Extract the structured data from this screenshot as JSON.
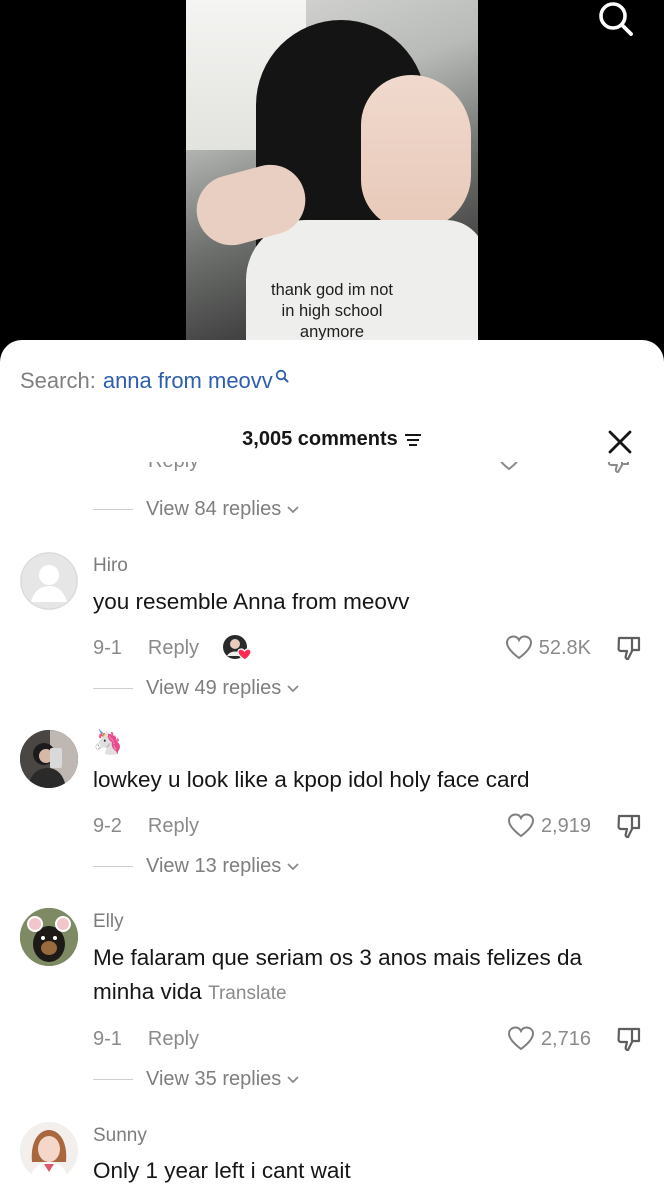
{
  "video": {
    "caption_lines": [
      "thank god im not",
      "in high school",
      "anymore"
    ]
  },
  "sheet": {
    "search_label": "Search:",
    "search_query": "anna from meovv",
    "comment_count": "3,005 comments",
    "cut_row": {
      "reply_label": "Reply"
    },
    "first_replies": "View 84 replies"
  },
  "comments": [
    {
      "username": "Hiro",
      "text": "you resemble Anna from meovv",
      "date": "9-1",
      "reply_label": "Reply",
      "likes": "52.8K",
      "replies": "View 49 replies",
      "creator_liked": true
    },
    {
      "username": "🦄",
      "text": "lowkey u look like a kpop idol holy face card",
      "date": "9-2",
      "reply_label": "Reply",
      "likes": "2,919",
      "replies": "View 13 replies"
    },
    {
      "username": "Elly",
      "text": "Me falaram que seriam os 3 anos mais felizes da minha vida",
      "translate_label": "Translate",
      "date": "9-1",
      "reply_label": "Reply",
      "likes": "2,716",
      "replies": "View 35 replies"
    },
    {
      "username": "Sunny",
      "text": "Only 1 year left i cant wait"
    }
  ],
  "colors": {
    "query_link": "#2d5fae",
    "sheet_bg": "#ffffff",
    "muted_text": "#8a8a8a",
    "creator_heart": "#fe2c55"
  },
  "icons": {
    "top_search": "search-icon",
    "query": "search-icon",
    "sort": "sort-icon",
    "close": "close-icon",
    "like": "heart-icon",
    "dislike": "thumbs-down-icon",
    "replies": "chevron-down-icon"
  }
}
